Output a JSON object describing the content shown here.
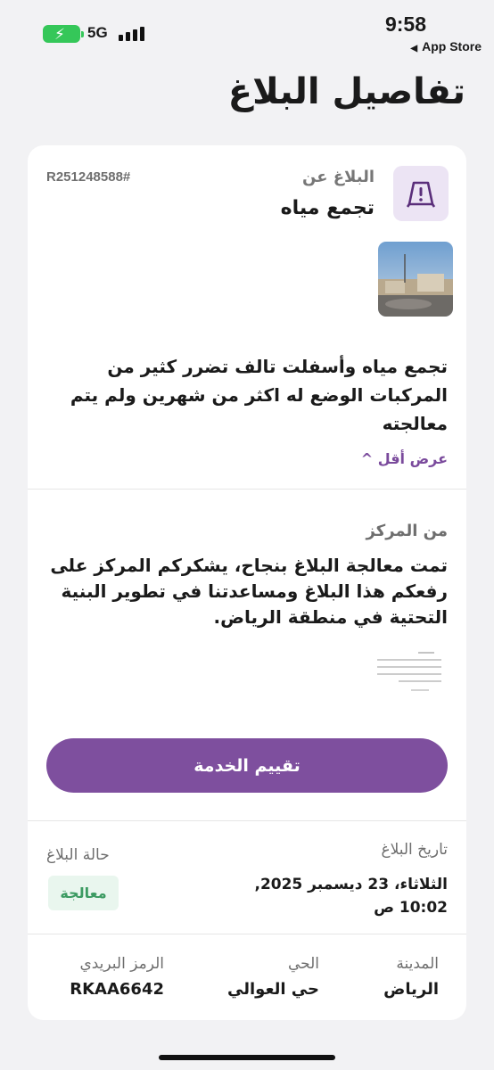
{
  "status_bar": {
    "network": "5G",
    "time": "9:58",
    "back_app": "App Store",
    "battery_color": "#35c759"
  },
  "page": {
    "title": "تفاصيل البلاغ"
  },
  "report": {
    "about_label": "البلاغ عن",
    "type": "تجمع مياه",
    "id": "R251248588#",
    "icon": "warning-sign-icon",
    "description": "تجمع مياه وأسفلت تالف تضرر كثير من المركبات الوضع له اكثر من شهرين ولم يتم معالجته",
    "show_less": "عرض أقل"
  },
  "center": {
    "from_label": "من المركز",
    "reply": "تمت معالجة البلاغ بنجاح، يشكركم المركز على رفعكم هذا البلاغ ومساعدتنا في تطوير البنية التحتية في منطقة الرياض."
  },
  "actions": {
    "rate_service": "تقييم الخدمة"
  },
  "details": {
    "date_label": "تاريخ البلاغ",
    "date_value": "الثلاثاء، 23 ديسمبر 2025, 10:02 ص",
    "status_label": "حالة البلاغ",
    "status_value": "معالجة",
    "city_label": "المدينة",
    "city_value": "الرياض",
    "neighborhood_label": "الحي",
    "neighborhood_value": "حي العوالي",
    "postal_label": "الرمز البريدي",
    "postal_value": "RKAA6642"
  },
  "colors": {
    "accent": "#7e4f9e",
    "status_green": "#3c9b62"
  }
}
